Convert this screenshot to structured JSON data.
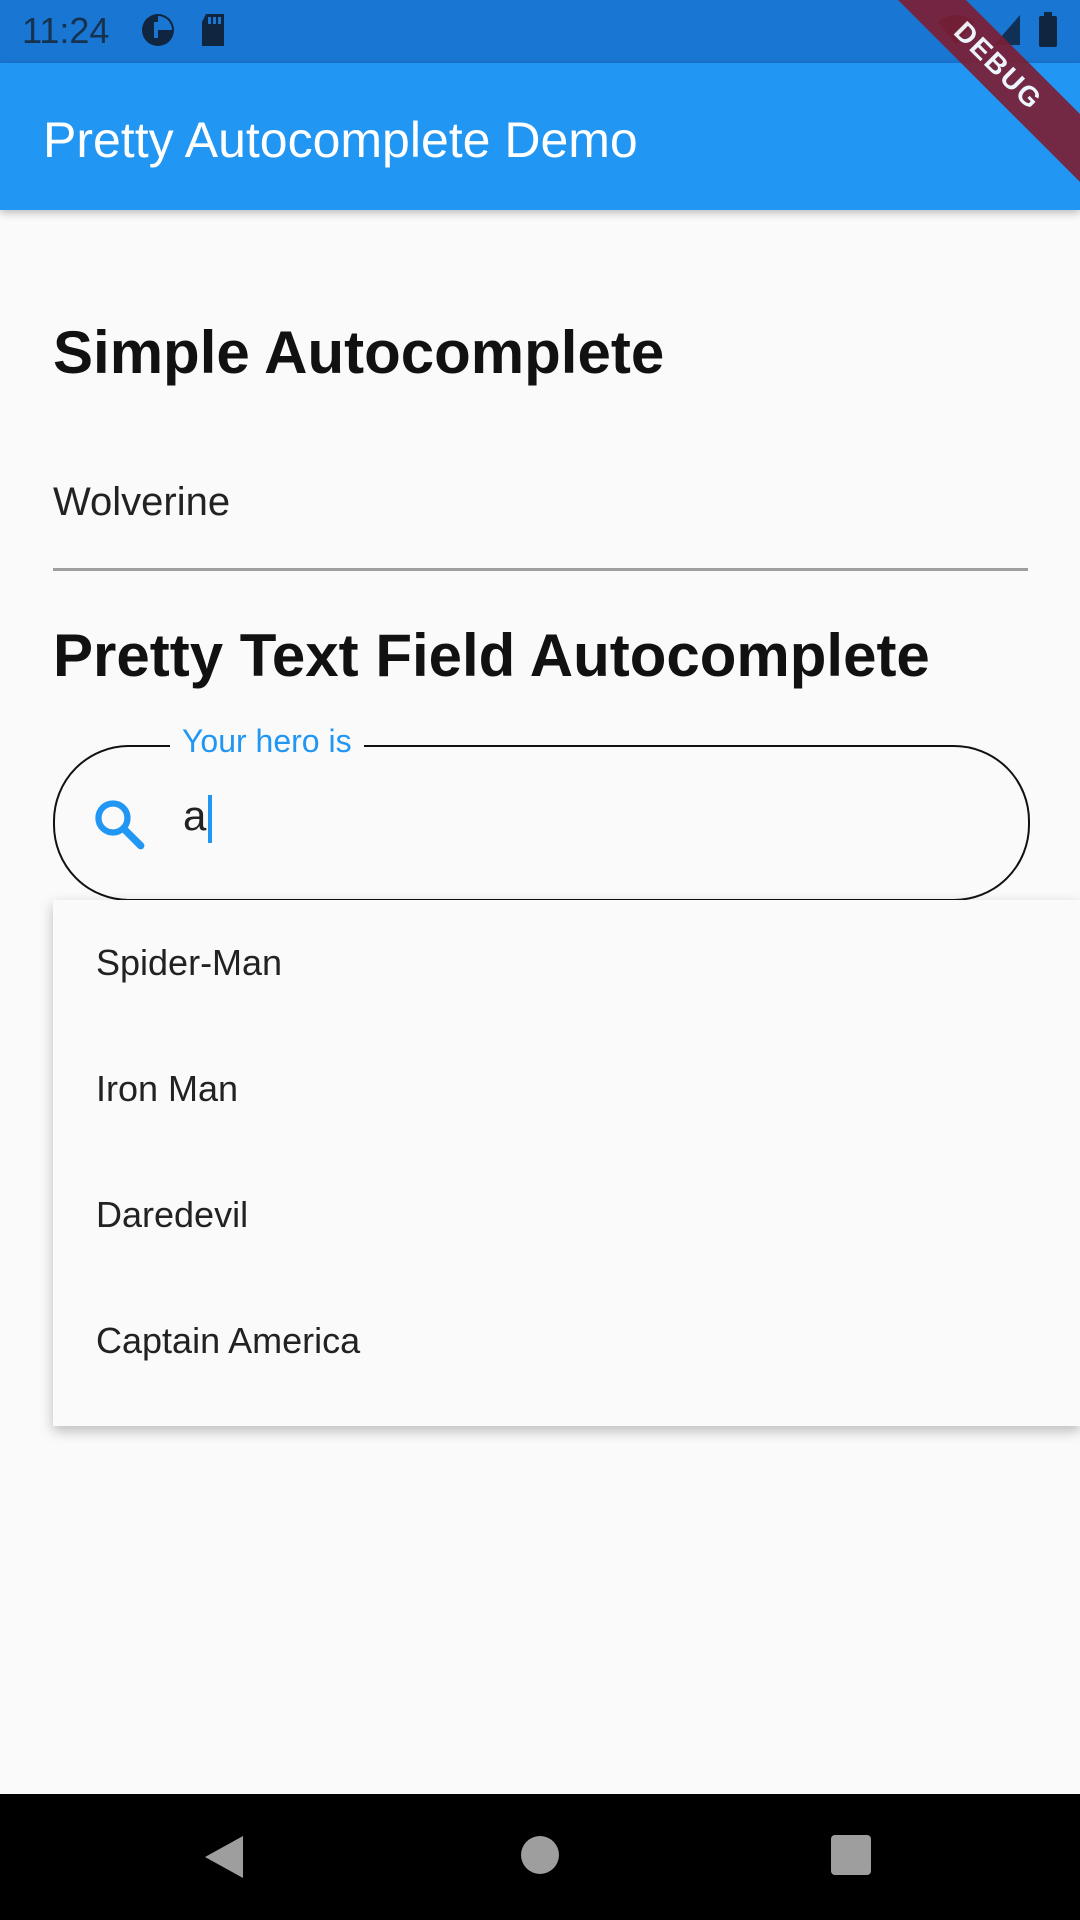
{
  "status": {
    "time": "11:24",
    "left_icons": [
      "pie-icon",
      "sd-card-icon"
    ],
    "right_icons": [
      "wifi-icon",
      "signal-icon",
      "battery-icon"
    ]
  },
  "appbar": {
    "title": "Pretty Autocomplete Demo",
    "debug_label": "DEBUG",
    "colors": {
      "appbar": "#2196f3",
      "statusbar": "#1976d2",
      "debug": "#7b1f35"
    }
  },
  "sections": {
    "simple_title": "Simple Autocomplete",
    "simple_value": "Wolverine",
    "pretty_title": "Pretty Text Field Autocomplete",
    "pretty_label": "Your hero is",
    "pretty_value": "a"
  },
  "suggestions": [
    "Spider-Man",
    "Iron Man",
    "Daredevil",
    "Captain America"
  ],
  "nav": {
    "icons": [
      "back-icon",
      "home-icon",
      "recents-icon"
    ]
  }
}
